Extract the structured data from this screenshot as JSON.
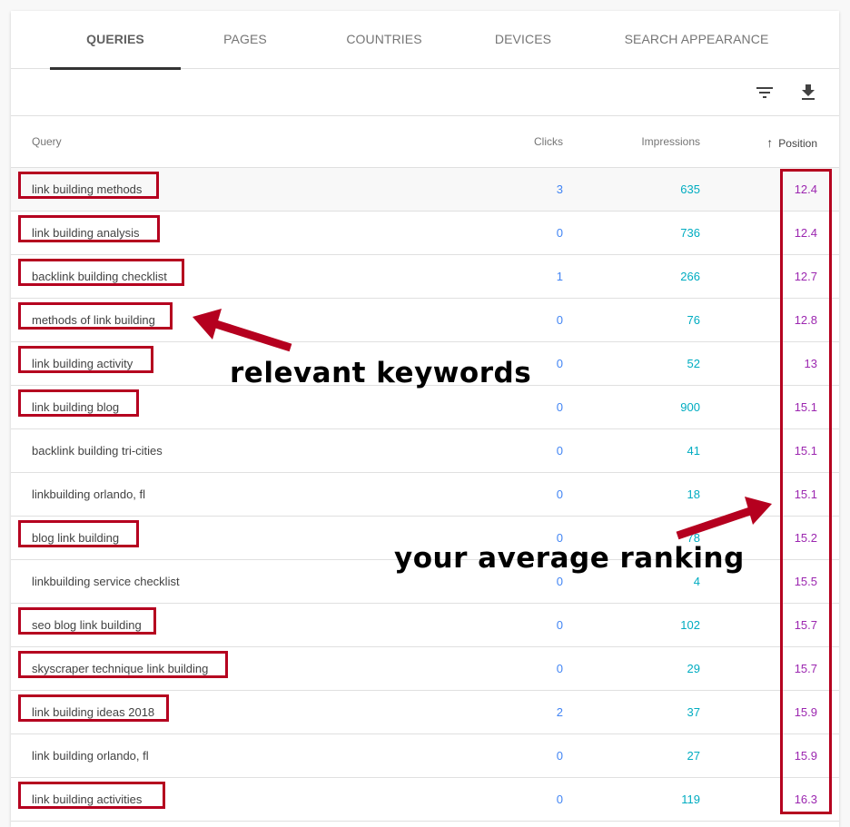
{
  "tabs": [
    {
      "label": "QUERIES",
      "active": true
    },
    {
      "label": "PAGES",
      "active": false
    },
    {
      "label": "COUNTRIES",
      "active": false
    },
    {
      "label": "DEVICES",
      "active": false
    },
    {
      "label": "SEARCH APPEARANCE",
      "active": false
    }
  ],
  "toolbar": {
    "filter_icon": "filter-icon",
    "download_icon": "download-icon"
  },
  "columns": {
    "query": "Query",
    "clicks": "Clicks",
    "impressions": "Impressions",
    "position": "Position",
    "sort_icon": "arrow-up-icon"
  },
  "rows": [
    {
      "query": "link building methods",
      "clicks": "3",
      "impressions": "635",
      "position": "12.4",
      "highlighted": true
    },
    {
      "query": "link building analysis",
      "clicks": "0",
      "impressions": "736",
      "position": "12.4",
      "highlighted": true
    },
    {
      "query": "backlink building checklist",
      "clicks": "1",
      "impressions": "266",
      "position": "12.7",
      "highlighted": true
    },
    {
      "query": "methods of link building",
      "clicks": "0",
      "impressions": "76",
      "position": "12.8",
      "highlighted": true
    },
    {
      "query": "link building activity",
      "clicks": "0",
      "impressions": "52",
      "position": "13",
      "highlighted": true
    },
    {
      "query": "link building blog",
      "clicks": "0",
      "impressions": "900",
      "position": "15.1",
      "highlighted": true
    },
    {
      "query": "backlink building tri-cities",
      "clicks": "0",
      "impressions": "41",
      "position": "15.1",
      "highlighted": false
    },
    {
      "query": "linkbuilding orlando, fl",
      "clicks": "0",
      "impressions": "18",
      "position": "15.1",
      "highlighted": false
    },
    {
      "query": "blog link building",
      "clicks": "0",
      "impressions": "78",
      "position": "15.2",
      "highlighted": true
    },
    {
      "query": "linkbuilding service checklist",
      "clicks": "0",
      "impressions": "4",
      "position": "15.5",
      "highlighted": false
    },
    {
      "query": "seo blog link building",
      "clicks": "0",
      "impressions": "102",
      "position": "15.7",
      "highlighted": true
    },
    {
      "query": "skyscraper technique link building",
      "clicks": "0",
      "impressions": "29",
      "position": "15.7",
      "highlighted": true
    },
    {
      "query": "link building ideas 2018",
      "clicks": "2",
      "impressions": "37",
      "position": "15.9",
      "highlighted": true
    },
    {
      "query": "link building orlando, fl",
      "clicks": "0",
      "impressions": "27",
      "position": "15.9",
      "highlighted": false
    },
    {
      "query": "link building activities",
      "clicks": "0",
      "impressions": "119",
      "position": "16.3",
      "highlighted": true
    }
  ],
  "annotations": {
    "keywords": "relevant keywords",
    "ranking": "your average ranking"
  },
  "colors": {
    "highlight": "#b5001f",
    "clicks": "#4285f4",
    "impressions": "#00acc1",
    "position": "#9c27b0"
  }
}
